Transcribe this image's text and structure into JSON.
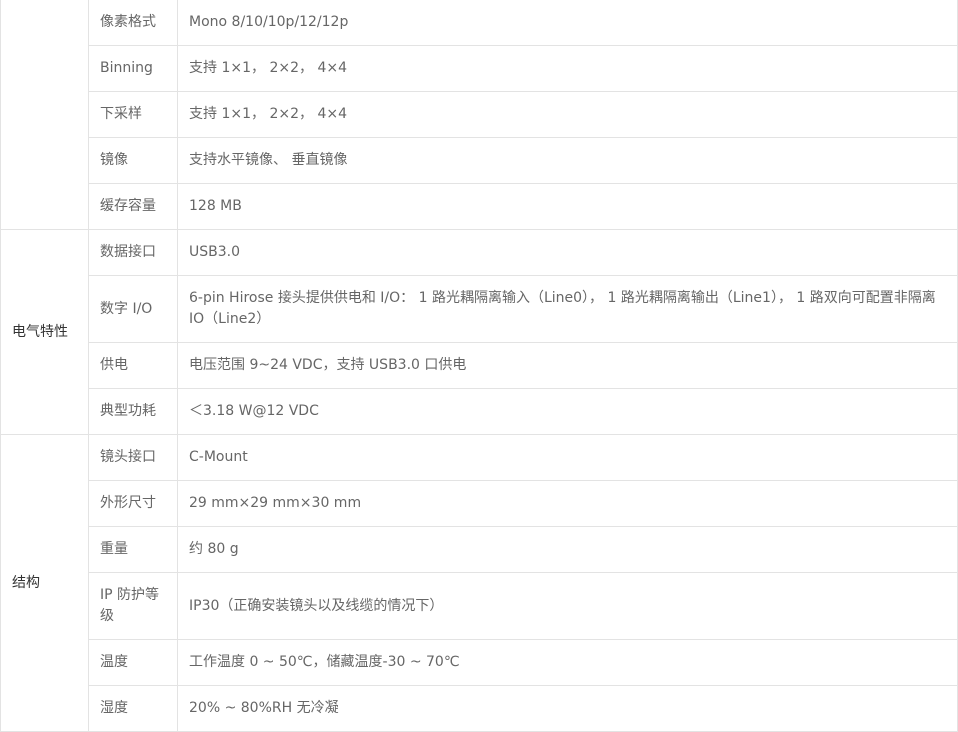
{
  "groups": [
    {
      "label": "",
      "rows": [
        {
          "label": "像素格式",
          "value": "Mono 8/10/10p/12/12p"
        },
        {
          "label": "Binning",
          "value": "支持 1×1， 2×2， 4×4"
        },
        {
          "label": "下采样",
          "value": "支持 1×1， 2×2， 4×4"
        },
        {
          "label": "镜像",
          "value": "支持水平镜像、 垂直镜像"
        },
        {
          "label": "缓存容量",
          "value": "128 MB"
        }
      ]
    },
    {
      "label": "电气特性",
      "rows": [
        {
          "label": "数据接口",
          "value": "USB3.0"
        },
        {
          "label": "数字 I/O",
          "value": "6-pin Hirose 接头提供供电和 I/O： 1 路光耦隔离输入（Line0）， 1 路光耦隔离输出（Line1）， 1 路双向可配置非隔离 IO（Line2）"
        },
        {
          "label": "供电",
          "value": "电压范围 9~24 VDC，支持 USB3.0 口供电"
        },
        {
          "label": "典型功耗",
          "value": "＜3.18 W@12 VDC"
        }
      ]
    },
    {
      "label": "结构",
      "rows": [
        {
          "label": "镜头接口",
          "value": "C-Mount"
        },
        {
          "label": "外形尺寸",
          "value": "29 mm×29 mm×30 mm"
        },
        {
          "label": "重量",
          "value": "约 80 g"
        },
        {
          "label": "IP 防护等级",
          "value": "IP30（正确安装镜头以及线缆的情况下）"
        },
        {
          "label": "温度",
          "value": "工作温度 0 ~ 50℃，储藏温度-30 ~ 70℃"
        },
        {
          "label": "湿度",
          "value": "20% ~ 80%RH 无冷凝"
        }
      ]
    }
  ]
}
